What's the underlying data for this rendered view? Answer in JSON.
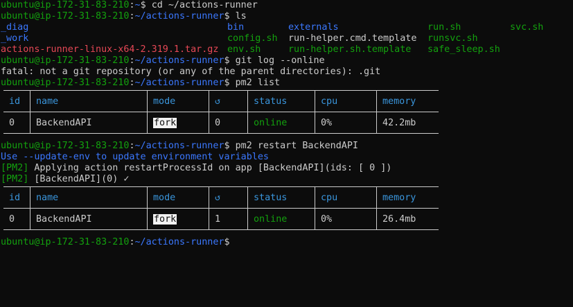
{
  "prompt": {
    "user_host": "ubuntu@ip-172-31-83-210",
    "home_path": "~",
    "runner_path": "~/actions-runner",
    "symbol": "$"
  },
  "commands": {
    "cd": "cd ~/actions-runner",
    "ls": "ls",
    "git": "git log --online",
    "pm2_list": "pm2 list",
    "pm2_restart": "pm2 restart BackendAPI"
  },
  "ls_rows": [
    [
      "_diag",
      "bin",
      "externals",
      "run.sh",
      "svc.sh"
    ],
    [
      "_work",
      "config.sh",
      "run-helper.cmd.template",
      "runsvc.sh",
      ""
    ],
    [
      "actions-runner-linux-x64-2.319.1.tar.gz",
      "env.sh",
      "run-helper.sh.template",
      "safe_sleep.sh",
      ""
    ]
  ],
  "git_error": "fatal: not a git repository (or any of the parent directories): .git",
  "pm2_headers": [
    "id",
    "name",
    "mode",
    "↺",
    "status",
    "cpu",
    "memory"
  ],
  "pm2_list_row": {
    "id": "0",
    "name": "BackendAPI",
    "mode": "fork",
    "restarts": "0",
    "status": "online",
    "cpu": "0%",
    "memory": "42.2mb"
  },
  "restart_output": {
    "warning": "Use --update-env to update environment variables",
    "tag": "[PM2]",
    "applying": " Applying action restartProcessId on app [BackendAPI](ids: [ 0 ])",
    "done": " [BackendAPI](0) ✓"
  },
  "pm2_restart_row": {
    "id": "0",
    "name": "BackendAPI",
    "mode": "fork",
    "restarts": "1",
    "status": "online",
    "cpu": "0%",
    "memory": "26.4mb"
  },
  "colors": {
    "green": "#13a10e",
    "blue": "#3b78ff",
    "red": "#e74856",
    "cyan": "#3a96dd",
    "fg": "#cccccc",
    "bg": "#0c0c0c"
  }
}
